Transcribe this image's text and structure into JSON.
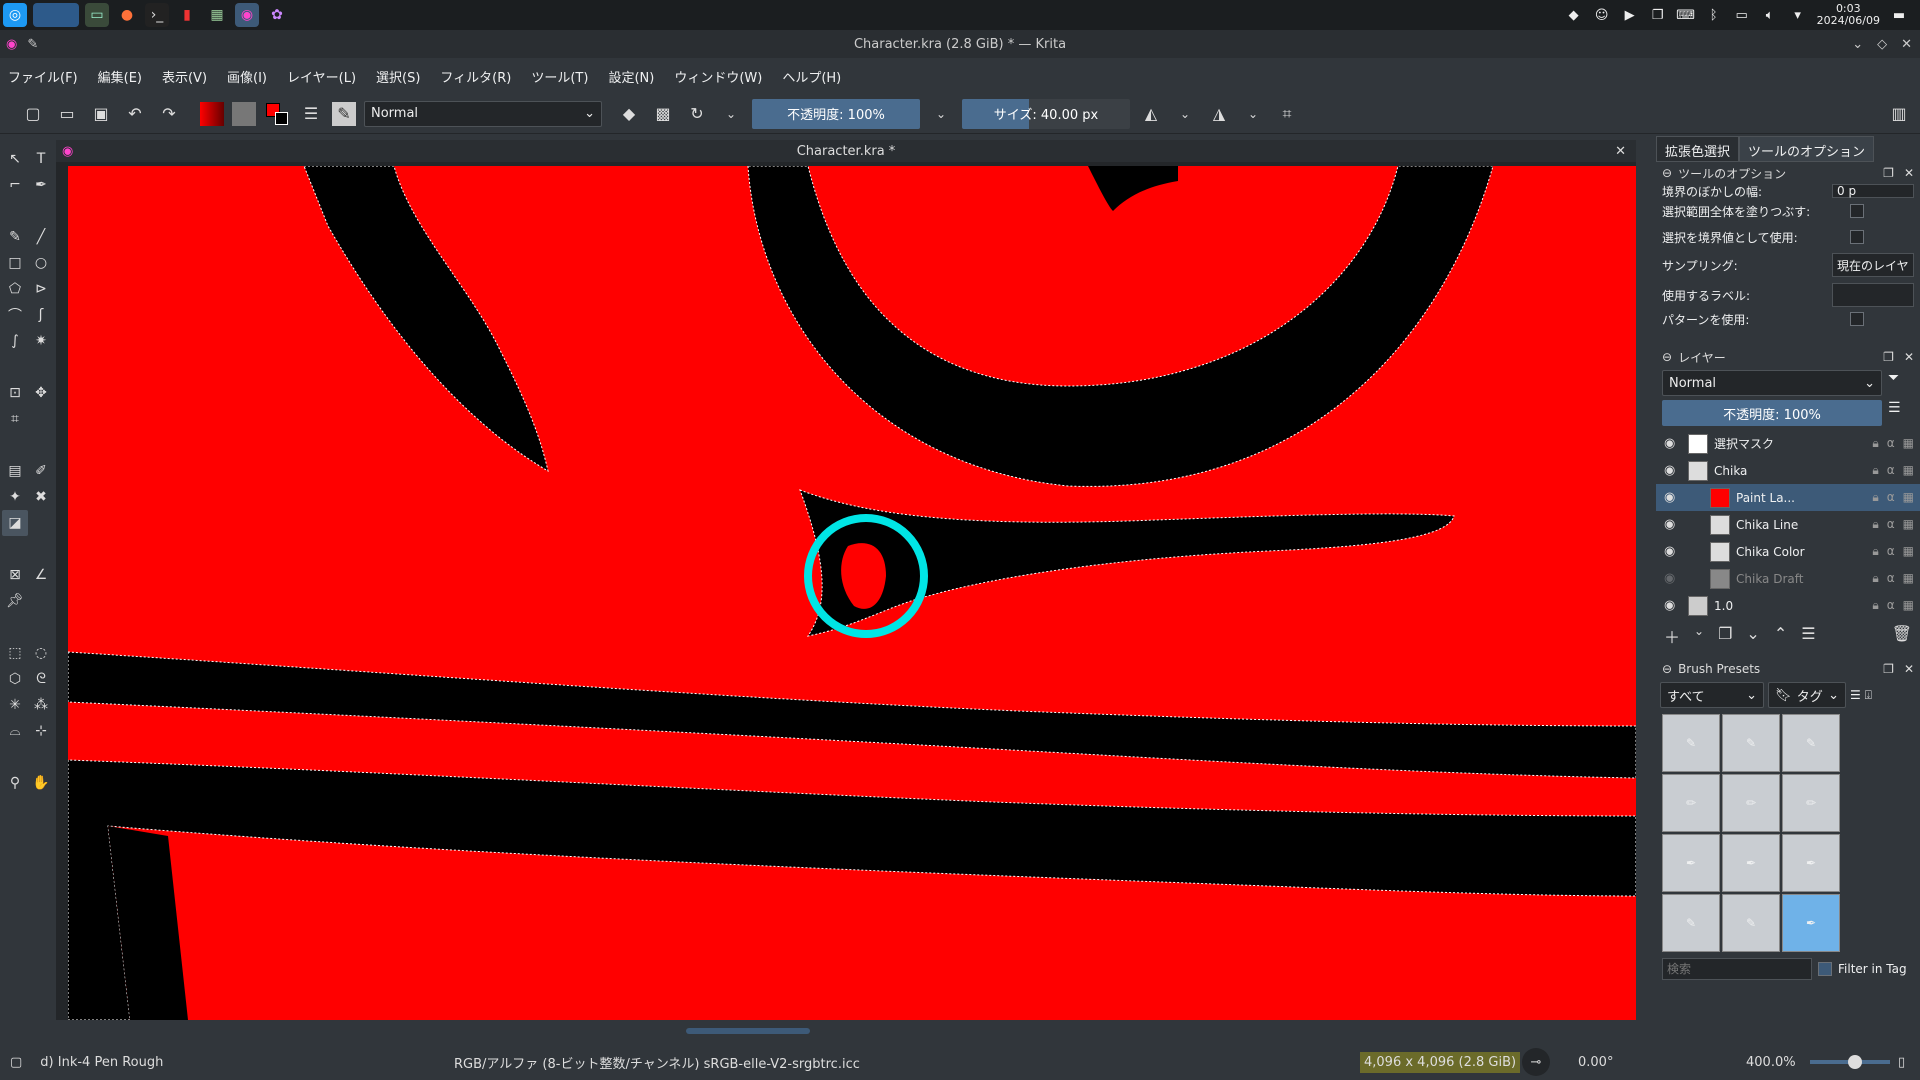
{
  "taskbar": {
    "icons": [
      "kde-icon",
      "desktop-switcher-icon",
      "file-manager-icon",
      "firefox-icon",
      "terminal-icon",
      "document-viewer-icon",
      "app-grid-icon",
      "krita-icon",
      "paint-icon"
    ],
    "clock": {
      "time": "0:03",
      "date": "2024/06/09"
    }
  },
  "window": {
    "title": "Character.kra (2.8 GiB) * — Krita"
  },
  "menu": [
    "ファイル(F)",
    "編集(E)",
    "表示(V)",
    "画像(I)",
    "レイヤー(L)",
    "選択(S)",
    "フィルタ(R)",
    "ツール(T)",
    "設定(N)",
    "ウィンドウ(W)",
    "ヘルプ(H)"
  ],
  "toolbar": {
    "blend_mode": "Normal",
    "opacity_label": "不透明度: 100%",
    "opacity": 1.0,
    "size_label": "サイズ: 40.00 px",
    "size_fraction": 0.4
  },
  "document": {
    "tab_title": "Character.kra *"
  },
  "right_panel": {
    "tabs": [
      "拡張色選択",
      "ツールのオプション"
    ],
    "tool_options": {
      "title": "ツールのオプション",
      "rows": [
        {
          "label": "境界のぼかしの幅:",
          "value": "0 p"
        },
        {
          "label": "選択範囲全体を塗りつぶす:",
          "value": ""
        },
        {
          "label": "選択を境界値として使用:",
          "value": ""
        },
        {
          "label": "サンプリング:",
          "value": "現在のレイヤ"
        },
        {
          "label": "使用するラベル:",
          "value": ""
        },
        {
          "label": "パターンを使用:",
          "value": ""
        }
      ]
    },
    "layers": {
      "title": "レイヤー",
      "blend": "Normal",
      "opacity_label": "不透明度: 100%",
      "items": [
        {
          "name": "選択マスク",
          "visible": true,
          "selected": false,
          "indent": 0
        },
        {
          "name": "Chika",
          "visible": true,
          "selected": false,
          "indent": 0
        },
        {
          "name": "Paint La...",
          "visible": true,
          "selected": true,
          "indent": 1
        },
        {
          "name": "Chika Line",
          "visible": true,
          "selected": false,
          "indent": 1
        },
        {
          "name": "Chika Color",
          "visible": true,
          "selected": false,
          "indent": 1
        },
        {
          "name": "Chika Draft",
          "visible": false,
          "selected": false,
          "indent": 1
        },
        {
          "name": "1.0",
          "visible": true,
          "selected": false,
          "indent": 0
        }
      ]
    },
    "brushes": {
      "title": "Brush Presets",
      "filter": "すべて",
      "tag": "タグ",
      "search_placeholder": "検索",
      "filter_in_tag": "Filter in Tag"
    }
  },
  "status": {
    "brush": "d) Ink-4 Pen Rough",
    "color_space": "RGB/アルファ (8-ビット整数/チャンネル)  sRGB-elle-V2-srgbtrc.icc",
    "image_size": "4,096 x 4,096 (2.8 GiB)",
    "rotation": "0.00°",
    "zoom": "400.0%"
  },
  "colors": {
    "canvas_red": "#ff0000",
    "ink": "#000000",
    "marker": "#00e5e5",
    "accent": "#3d5a78"
  }
}
